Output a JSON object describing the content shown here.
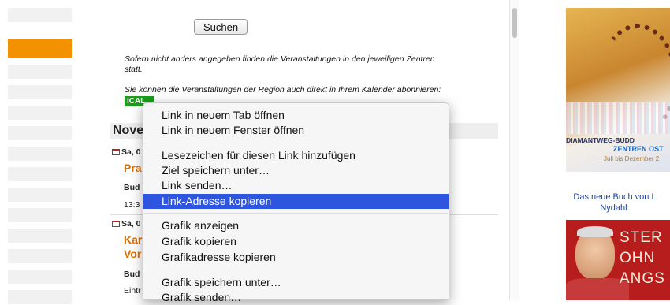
{
  "main": {
    "search_button": "Suchen",
    "note1_line1": "Sofern nicht anders angegeben finden die Veranstaltungen in den jeweiligen Zentren",
    "note1_line2": "statt.",
    "note2": "Sie können die Veranstaltungen der Region auch direkt in Ihrem Kalender abonnieren:",
    "ical_badge": "ICAL",
    "month_heading": "Nove",
    "events": [
      {
        "date": "Sa, 0",
        "title": "Pra",
        "category": "Bud",
        "time": "13:3"
      },
      {
        "date": "Sa, 0",
        "title_line1": "Kar",
        "title_line2": "Vor",
        "category": "Bud",
        "info": "Eintr"
      }
    ]
  },
  "right": {
    "ad1_line1": "DIAMANTWEG-BUDD",
    "ad1_line2": "ZENTREN OST",
    "ad1_line3": "Juli bis Dezember 2",
    "book_text_line1": "Das neue Buch von L",
    "book_text_line2": "Nydahl:",
    "ad2_lines": [
      "STER",
      "OHN",
      "ANGS"
    ]
  },
  "context_menu": {
    "items": [
      "Link in neuem Tab öffnen",
      "Link in neuem Fenster öffnen",
      "Lesezeichen für diesen Link hinzufügen",
      "Ziel speichern unter…",
      "Link senden…",
      "Link-Adresse kopieren",
      "Grafik anzeigen",
      "Grafik kopieren",
      "Grafikadresse kopieren",
      "Grafik speichern unter…",
      "Grafik senden…"
    ],
    "selected_item": "Link-Adresse kopieren"
  },
  "colors": {
    "accent_orange": "#f39200",
    "selection_blue": "#2d55e0",
    "ical_green": "#1a9e1a",
    "event_title_orange": "#e06d00"
  }
}
